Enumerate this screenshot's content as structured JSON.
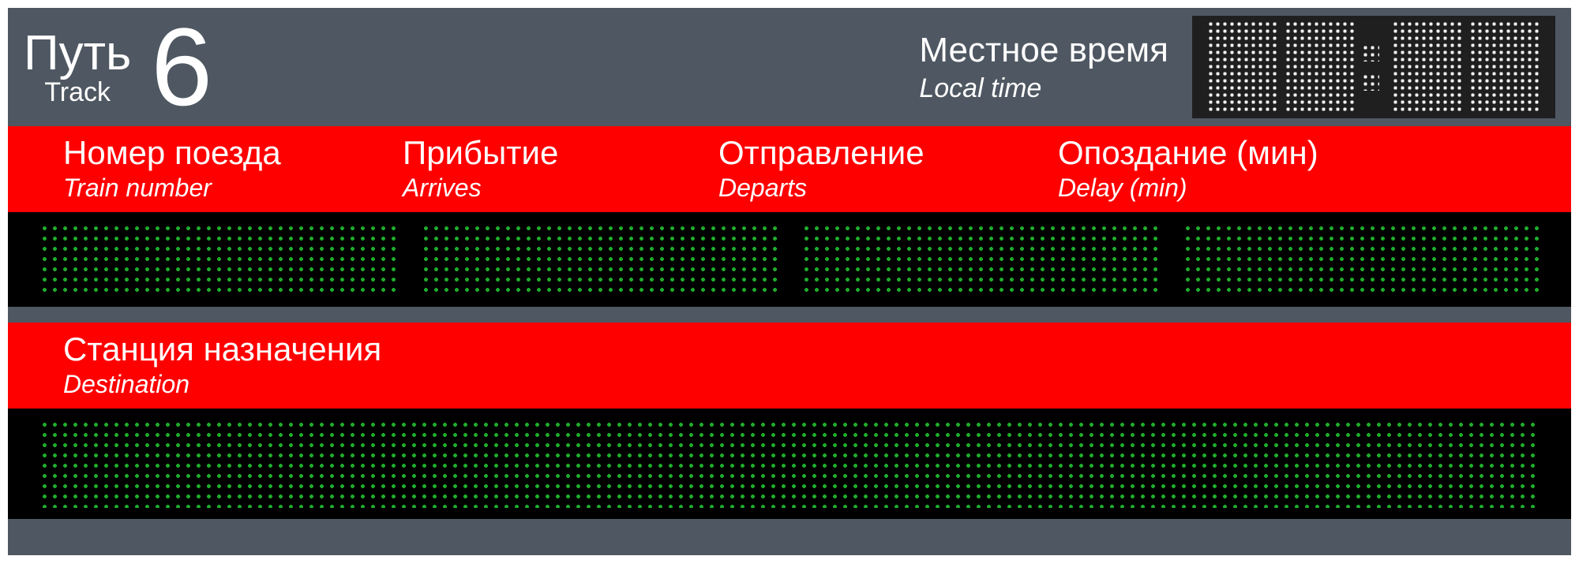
{
  "header": {
    "track_label_ru": "Путь",
    "track_label_en": "Track",
    "track_number": "6",
    "time_label_ru": "Местное время",
    "time_label_en": "Local time",
    "clock_value": "88:88"
  },
  "columns": {
    "train": {
      "ru": "Номер поезда",
      "en": "Train number"
    },
    "arrives": {
      "ru": "Прибытие",
      "en": "Arrives"
    },
    "departs": {
      "ru": "Отправление",
      "en": "Departs"
    },
    "delay": {
      "ru": "Опоздание (мин)",
      "en": "Delay (min)"
    }
  },
  "destination": {
    "ru": "Станция назначения",
    "en": "Destination"
  },
  "led_values": {
    "train": "",
    "arrives": "",
    "departs": "",
    "delay": "",
    "destination": ""
  }
}
